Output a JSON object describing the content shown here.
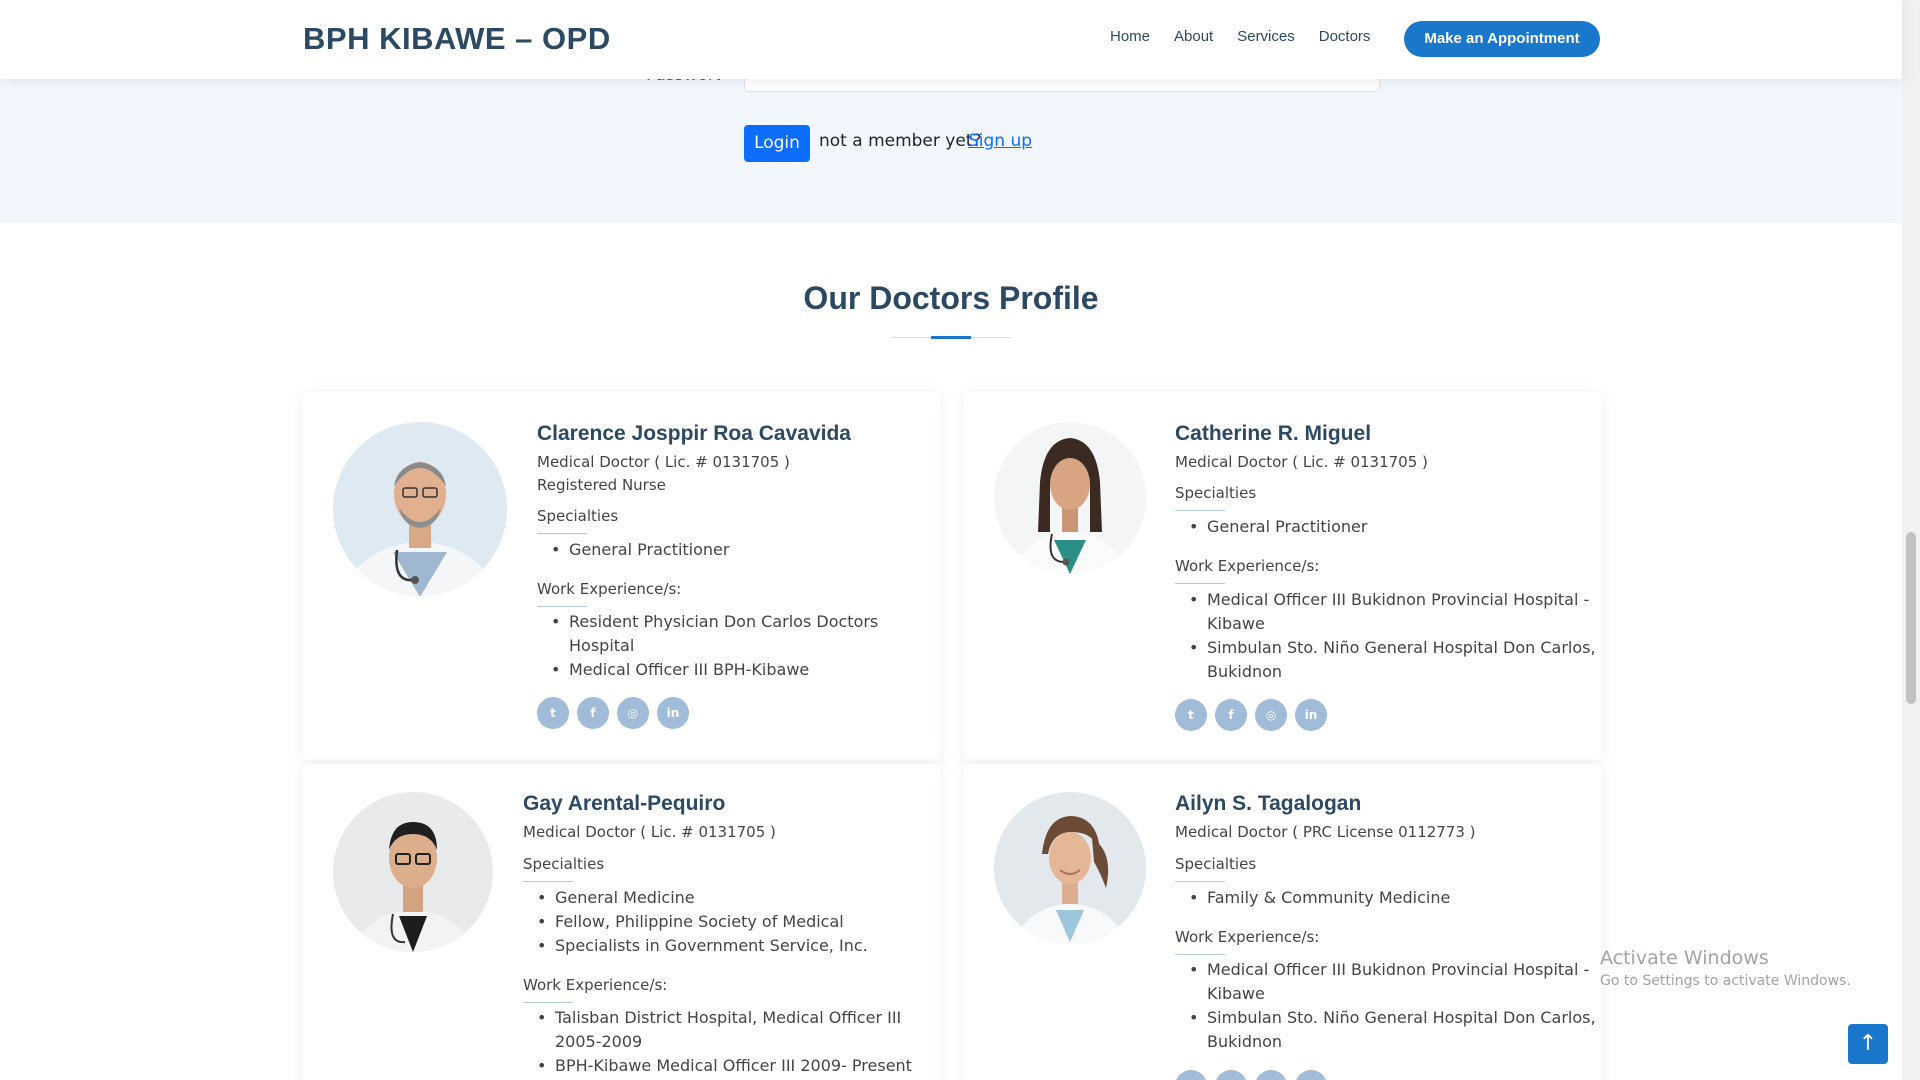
{
  "header": {
    "logo": "BPH KIBAWE – OPD",
    "nav": [
      "Home",
      "About",
      "Services",
      "Doctors"
    ],
    "appointment_button": "Make an Appointment"
  },
  "login": {
    "password_label": "Password",
    "login_button": "Login",
    "member_text": "not a member yet?",
    "signup_link": "Sign up"
  },
  "section": {
    "title": "Our Doctors Profile"
  },
  "doctors": [
    {
      "name": "Clarence Josppir Roa Cavavida",
      "title": "Medical Doctor ( Lic. # 0131705 )",
      "extra": "Registered Nurse",
      "specialties_label": "Specialties",
      "specialties": [
        "General Practitioner"
      ],
      "work_label": "Work Experience/s:",
      "work": [
        "Resident Physician Don Carlos Doctors",
        "Hospital",
        "Medical Officer III BPH-Kibawe"
      ]
    },
    {
      "name": "Catherine R. Miguel",
      "title": "Medical Doctor ( Lic. # 0131705 )",
      "specialties_label": "Specialties",
      "specialties": [
        "General Practitioner"
      ],
      "work_label": "Work Experience/s:",
      "work": [
        "Medical Officer III Bukidnon Provincial Hospital -",
        "Kibawe",
        "Simbulan Sto. Niño General Hospital Don Carlos,",
        "Bukidnon"
      ]
    },
    {
      "name": "Gay Arental-Pequiro",
      "title": "Medical Doctor ( Lic. # 0131705 )",
      "specialties_label": "Specialties",
      "specialties": [
        "General Medicine",
        "Fellow, Philippine Society of Medical",
        "Specialists in Government Service, Inc."
      ],
      "work_label": "Work Experience/s:",
      "work": [
        "Talisban District Hospital, Medical Officer III",
        "2005-2009",
        "BPH-Kibawe Medical Officer III 2009- Present"
      ]
    },
    {
      "name": "Ailyn S. Tagalogan",
      "title": "Medical Doctor ( PRC License 0112773 )",
      "specialties_label": "Specialties",
      "specialties": [
        "Family & Community Medicine"
      ],
      "work_label": "Work Experience/s:",
      "work": [
        "Medical Officer III Bukidnon Provincial Hospital -",
        "Kibawe",
        "Simbulan Sto. Niño General Hospital Don Carlos,",
        "Bukidnon"
      ]
    }
  ],
  "social_icons": [
    "twitter-icon",
    "facebook-icon",
    "instagram-icon",
    "linkedin-icon"
  ],
  "watermark": {
    "title": "Activate Windows",
    "subtitle": "Go to Settings to activate Windows."
  },
  "colors": {
    "brand": "#2c4964",
    "accent": "#1977cc",
    "login_button": "#0d6efd",
    "strip_bg": "#f1f7fd"
  }
}
